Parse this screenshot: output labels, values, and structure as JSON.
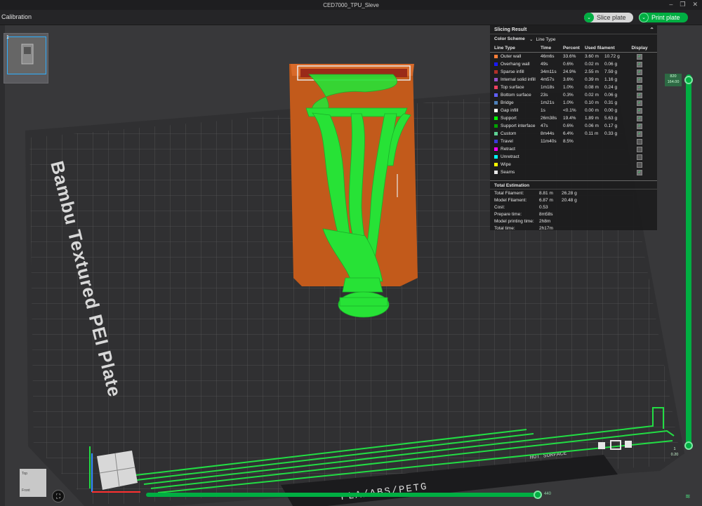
{
  "window": {
    "title": "CED7000_TPU_Sleve"
  },
  "topbar": {
    "tab_label": "Calibration",
    "slice_label": "Slice plate",
    "print_label": "Print plate"
  },
  "plate": {
    "number": "1",
    "bed_name": "Bambu Textured PEI Plate",
    "bed_materials": "PLA/ABS/PETG",
    "hot_surface": "HOT SURFACE"
  },
  "panel": {
    "title": "Slicing Result",
    "scheme_label": "Color Scheme",
    "scheme_value": "Line Type",
    "headers": [
      "Line Type",
      "Time",
      "Percent",
      "Used filament",
      "",
      "Display"
    ],
    "rows": [
      {
        "name": "Outer wall",
        "color": "#ff7d38",
        "time": "46m6s",
        "percent": "33.6%",
        "len": "3.60 m",
        "wt": "10.72 g",
        "on": true
      },
      {
        "name": "Overhang wall",
        "color": "#1919ff",
        "time": "49s",
        "percent": "0.6%",
        "len": "0.02 m",
        "wt": "0.06 g",
        "on": true
      },
      {
        "name": "Sparse infill",
        "color": "#b03029",
        "time": "34m11s",
        "percent": "24.9%",
        "len": "2.55 m",
        "wt": "7.59 g",
        "on": true
      },
      {
        "name": "Internal solid infill",
        "color": "#9654cc",
        "time": "4m57s",
        "percent": "3.6%",
        "len": "0.39 m",
        "wt": "1.16 g",
        "on": true
      },
      {
        "name": "Top surface",
        "color": "#f04060",
        "time": "1m18s",
        "percent": "1.0%",
        "len": "0.08 m",
        "wt": "0.24 g",
        "on": true
      },
      {
        "name": "Bottom surface",
        "color": "#6060ff",
        "time": "23s",
        "percent": "0.3%",
        "len": "0.02 m",
        "wt": "0.06 g",
        "on": true
      },
      {
        "name": "Bridge",
        "color": "#4d80ba",
        "time": "1m21s",
        "percent": "1.0%",
        "len": "0.10 m",
        "wt": "0.31 g",
        "on": true
      },
      {
        "name": "Gap infill",
        "color": "#ffffff",
        "time": "1s",
        "percent": "<0.1%",
        "len": "0.00 m",
        "wt": "0.00 g",
        "on": true
      },
      {
        "name": "Support",
        "color": "#00ff00",
        "time": "26m38s",
        "percent": "19.4%",
        "len": "1.89 m",
        "wt": "5.63 g",
        "on": true
      },
      {
        "name": "Support interface",
        "color": "#00a000",
        "time": "47s",
        "percent": "0.6%",
        "len": "0.06 m",
        "wt": "0.17 g",
        "on": true
      },
      {
        "name": "Custom",
        "color": "#5ed194",
        "time": "8m44s",
        "percent": "6.4%",
        "len": "0.11 m",
        "wt": "0.33 g",
        "on": true
      },
      {
        "name": "Travel",
        "color": "#3a3ad8",
        "time": "11m40s",
        "percent": "8.5%",
        "len": "",
        "wt": "",
        "on": false
      },
      {
        "name": "Retract",
        "color": "#ff00ff",
        "time": "",
        "percent": "",
        "len": "",
        "wt": "",
        "on": false
      },
      {
        "name": "Unretract",
        "color": "#00ffff",
        "time": "",
        "percent": "",
        "len": "",
        "wt": "",
        "on": false
      },
      {
        "name": "Wipe",
        "color": "#ffff00",
        "time": "",
        "percent": "",
        "len": "",
        "wt": "",
        "on": false
      },
      {
        "name": "Seams",
        "color": "#e6e6e6",
        "time": "",
        "percent": "",
        "len": "",
        "wt": "",
        "on": true
      }
    ],
    "total_title": "Total Estimation",
    "totals": [
      {
        "k": "Total Filament:",
        "v1": "8.81 m",
        "v2": "26.28 g"
      },
      {
        "k": "Model Filament:",
        "v1": "6.87 m",
        "v2": "20.48 g"
      },
      {
        "k": "Cost:",
        "v1": "0.53",
        "v2": ""
      },
      {
        "k": "Prepare time:",
        "v1": "8m58s",
        "v2": ""
      },
      {
        "k": "Model printing time:",
        "v1": "2h8m",
        "v2": ""
      },
      {
        "k": "Total time:",
        "v1": "2h17m",
        "v2": ""
      }
    ]
  },
  "layer_slider": {
    "top_a": "820",
    "top_b": "164.00",
    "bottom_a": "1",
    "bottom_b": "0.20"
  },
  "move_slider": {
    "label": "440"
  },
  "navcube": {
    "top": "Top",
    "front": "Front"
  },
  "colors": {
    "accent": "#00ae42",
    "model_orange": "#c45a1c",
    "support_green": "#27e236"
  }
}
